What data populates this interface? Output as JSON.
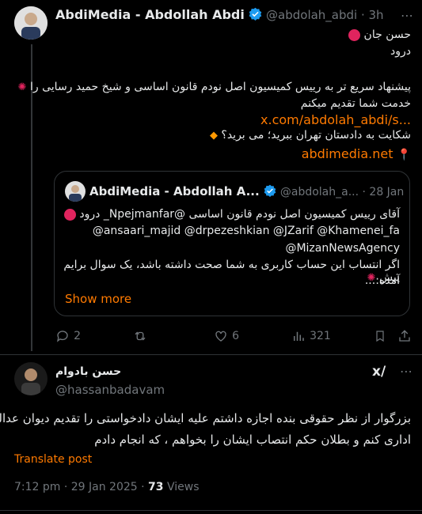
{
  "main_tweet": {
    "display_name": "AbdiMedia - Abdollah Abdi",
    "handle_time": "@abdolah_abdi · 3h",
    "line1": "حسن جان",
    "line2": "درود",
    "line3": "پیشنهاد سریع تر به رییس کمیسیون اصل نودم قانون اساسی و شیخ حمید رسایی را",
    "line4": "خدمت شما تقدیم میکنم",
    "link1": "x.com/abdolah_abdi/s...",
    "line5": "شکایت به دادستان تهران ببرید؛ می برید؟",
    "link2": "abdimedia.net"
  },
  "quote_tweet": {
    "display_name": "AbdiMedia - Abdollah A...",
    "handle_time": "@abdolah_a... · 28 Jan",
    "line1": "آقای رییس کمیسیون اصل نودم قانون اساسی @Npejmanfar_ درود",
    "line2": "@ansaari_majid @drpezeshkian @JZarif @Khamenei_fa",
    "line3": "@MizanNewsAgency",
    "line4": "اگر انتساب این حساب کاربری به شما صحت داشته باشد، یک سوال برایم پیش",
    "line5": "آمده:...",
    "show_more": "Show more"
  },
  "actions": {
    "replies": "2",
    "likes": "6",
    "views": "321"
  },
  "reply_tweet": {
    "display_name": "حسن بادوام",
    "handle": "@hassanbadavam",
    "line1": "بزرگوار از نظر حقوقی بنده اجازه داشتم علیه ایشان دادخواستی را تقدیم دیوان عدالت",
    "line2": "اداری کنم و بطلان حکم انتصاب ایشان را بخواهم ، که انجام دادم",
    "translate": "Translate post",
    "meta": "7:12 pm · 29 Jan 2025 ·",
    "views_count": "73",
    "views_label": "Views"
  }
}
